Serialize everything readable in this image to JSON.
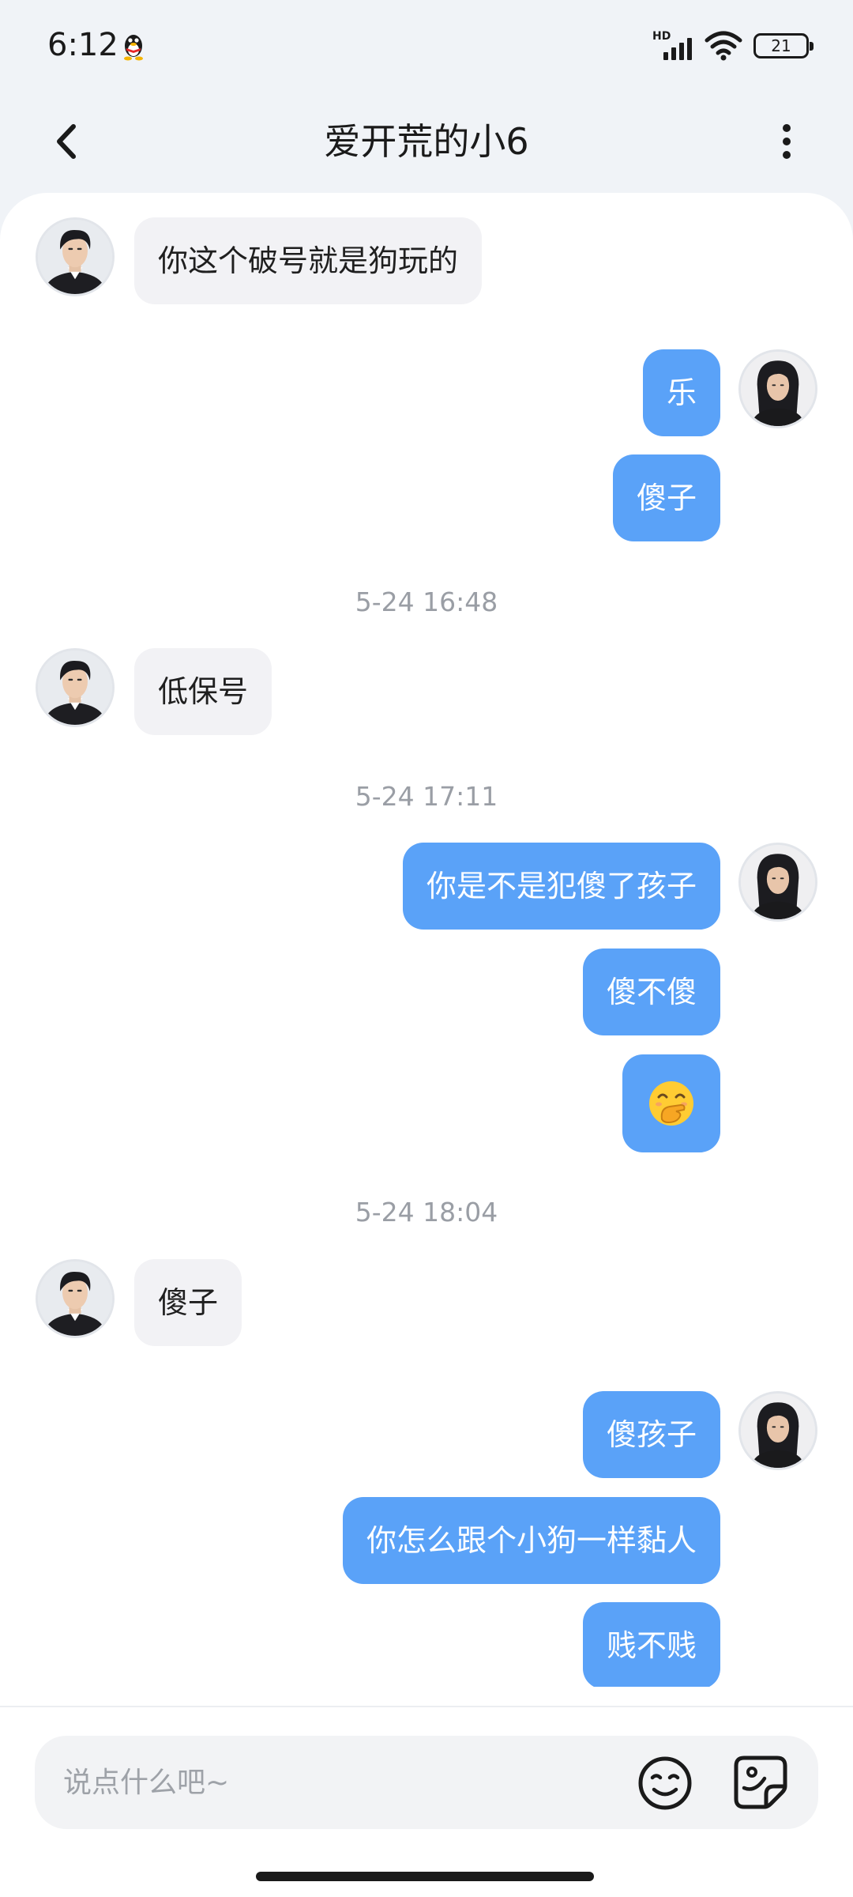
{
  "status_bar": {
    "time": "6:12",
    "network_label": "HD",
    "battery_level": "21",
    "icons": [
      "qq-penguin-icon",
      "hd-signal-icon",
      "wifi-icon",
      "battery-icon"
    ]
  },
  "nav": {
    "title": "爱开荒的小6",
    "back_icon": "chevron-left-icon",
    "more_icon": "more-vertical-icon"
  },
  "messages": [
    {
      "type": "in",
      "text": "你这个破号就是狗玩的"
    },
    {
      "type": "out",
      "text": "乐"
    },
    {
      "type": "out",
      "text": "傻子"
    },
    {
      "type": "time",
      "text": "5-24 16:48"
    },
    {
      "type": "in",
      "text": "低保号"
    },
    {
      "type": "time",
      "text": "5-24 17:11"
    },
    {
      "type": "out",
      "text": "你是不是犯傻了孩子"
    },
    {
      "type": "out",
      "text": "傻不傻"
    },
    {
      "type": "out",
      "emoji": "hand-over-mouth-emoji"
    },
    {
      "type": "time",
      "text": "5-24 18:04"
    },
    {
      "type": "in",
      "text": "傻子"
    },
    {
      "type": "out",
      "text": "傻孩子"
    },
    {
      "type": "out",
      "text": "你怎么跟个小狗一样黏人"
    },
    {
      "type": "out",
      "text": "贱不贱"
    }
  ],
  "input": {
    "placeholder": "说点什么吧~",
    "emoji_icon": "smiley-icon",
    "sticker_icon": "sticker-icon"
  },
  "colors": {
    "outgoing_bubble": "#5AA2F8",
    "incoming_bubble": "#F2F2F5",
    "timestamp": "#9A9EA5",
    "page_background": "#F0F3F7"
  }
}
